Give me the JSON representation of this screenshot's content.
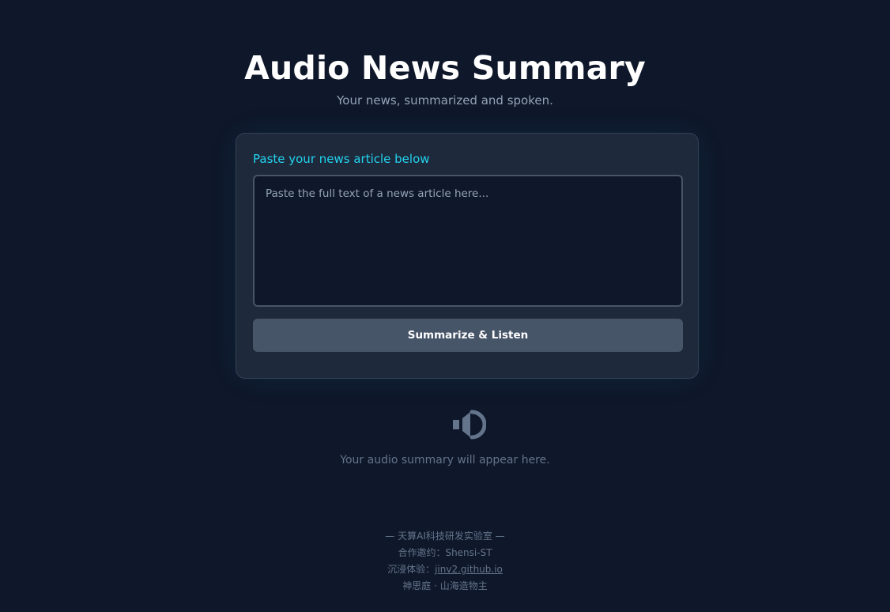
{
  "header": {
    "title": "Audio News Summary",
    "subtitle": "Your news, summarized and spoken."
  },
  "form": {
    "label": "Paste your news article below",
    "input_value": "",
    "input_placeholder": "Paste the full text of a news article here...",
    "submit_label": "Summarize & Listen"
  },
  "output": {
    "icon": "speaker-icon",
    "placeholder_text": "Your audio summary will appear here."
  },
  "footer": {
    "line1": "— 天算AI科技研发实验室 —",
    "line2": "合作邀约：Shensi-ST",
    "line3_prefix": "沉浸体验：",
    "line3_link": "jinv2.github.io",
    "line4": "神思庭 · 山海造物主"
  },
  "colors": {
    "background": "#0f172a",
    "card": "#1e293b",
    "accent": "#22d3ee",
    "button": "#475569"
  }
}
